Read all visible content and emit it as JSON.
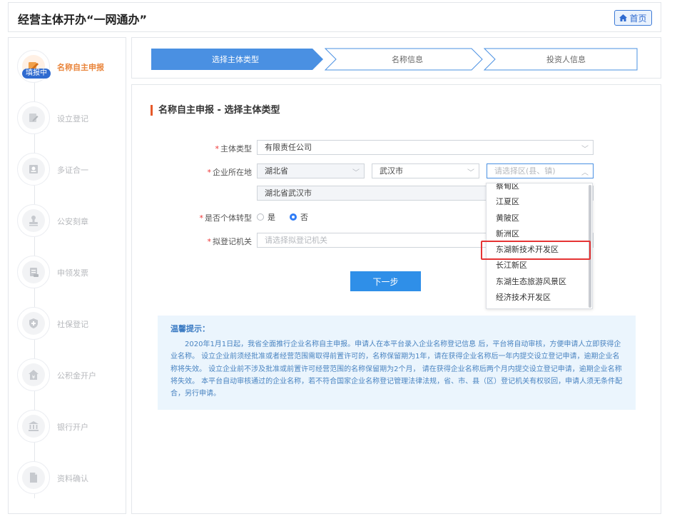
{
  "header": {
    "title": "经营主体开办“一网通办”",
    "home_label": "首页"
  },
  "sidebar": {
    "badge": "填报中",
    "steps": [
      {
        "label": "名称自主申报",
        "icon": "edit-icon"
      },
      {
        "label": "设立登记",
        "icon": "register-icon"
      },
      {
        "label": "多证合一",
        "icon": "certificate-icon"
      },
      {
        "label": "公安刻章",
        "icon": "stamp-icon"
      },
      {
        "label": "申领发票",
        "icon": "invoice-icon"
      },
      {
        "label": "社保登记",
        "icon": "social-security-icon"
      },
      {
        "label": "公积金开户",
        "icon": "housing-fund-icon"
      },
      {
        "label": "银行开户",
        "icon": "bank-icon"
      },
      {
        "label": "资料确认",
        "icon": "document-icon"
      }
    ]
  },
  "progress": {
    "steps": [
      "选择主体类型",
      "名称信息",
      "投资人信息"
    ],
    "active_index": 0
  },
  "form": {
    "section_title": "名称自主申报 - 选择主体类型",
    "entity_type": {
      "label": "主体类型",
      "value": "有限责任公司"
    },
    "location": {
      "label": "企业所在地",
      "province": "湖北省",
      "city": "武汉市",
      "district_placeholder": "请选择区(县、镇)",
      "address": "湖北省武汉市"
    },
    "individual_transform": {
      "label": "是否个体转型",
      "yes": "是",
      "no": "否",
      "selected": "否"
    },
    "authority": {
      "label": "拟登记机关",
      "placeholder": "请选择拟登记机关"
    },
    "next_label": "下一步"
  },
  "dropdown": {
    "options": [
      "蔡甸区",
      "江夏区",
      "黄陂区",
      "新洲区",
      "东湖新技术开发区",
      "长江新区",
      "东湖生态旅游风景区",
      "经济技术开发区"
    ],
    "highlighted": "东湖新技术开发区"
  },
  "tip": {
    "title": "温馨提示：",
    "body": "2020年1月1日起，我省全面推行企业名称自主申报。申请人在本平台录入企业名称登记信息 后，平台将自动审核，方便申请人立即获得企业名称。 设立企业前须经批准或者经营范围需取得前置许可的，名称保留期为1年，请在获得企业名称后一年内提交设立登记申请，逾期企业名称将失效。 设立企业前不涉及批准或前置许可经营范围的名称保留期为2个月， 请在获得企业名称后两个月内提交设立登记申请，逾期企业名称将失效。 本平台自动审核通过的企业名称，若不符合国家企业名称登记管理法律法规，省、市、县（区）登记机关有权驳回，申请人须无条件配合，另行申请。"
  },
  "colors": {
    "primary": "#4a90e2",
    "accent_orange": "#e9843a",
    "highlight_red": "#e53434",
    "tip_bg": "#ebf5fd"
  }
}
